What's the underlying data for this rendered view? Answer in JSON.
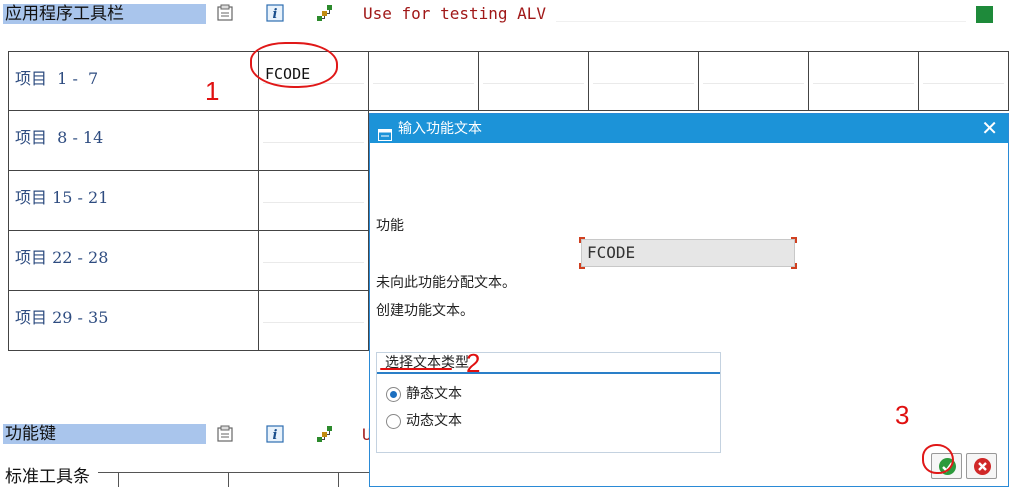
{
  "toolbar_app": {
    "label": "应用程序工具栏",
    "title_text": "Use for testing ALV"
  },
  "grid": {
    "rows": [
      {
        "label": "项目  1 -  7"
      },
      {
        "label": "项目  8 - 14"
      },
      {
        "label": "项目 15 - 21"
      },
      {
        "label": "项目 22 - 28"
      },
      {
        "label": "项目 29 - 35"
      }
    ],
    "first_cell_value": "FCODE"
  },
  "annotations": {
    "one": "1",
    "two": "2",
    "three": "3"
  },
  "dialog": {
    "title": "输入功能文本",
    "close_glyph": "✕",
    "function_label": "功能",
    "function_value": "FCODE",
    "msg_not_assigned": "未向此功能分配文本。",
    "msg_create": "创建功能文本。",
    "group_title": "选择文本类型",
    "radio_static": "静态文本",
    "radio_dynamic": "动态文本",
    "selected_text_type": "静态文本"
  },
  "toolbar_func": {
    "label": "功能键",
    "truncated_text": "U"
  },
  "std_toolbar": {
    "label": "标准工具条"
  },
  "colors": {
    "section_bg": "#a9c5ec",
    "dialog_title_bg": "#1c93d8",
    "annotation_red": "#e01010",
    "title_text_red": "#a01818",
    "green_status": "#1e8a3a"
  },
  "icons": {
    "toolbar": [
      "display-icon",
      "info-icon",
      "hierarchy-icon"
    ],
    "dialog_ok": "checkmark-icon",
    "dialog_cancel": "cancel-icon"
  }
}
